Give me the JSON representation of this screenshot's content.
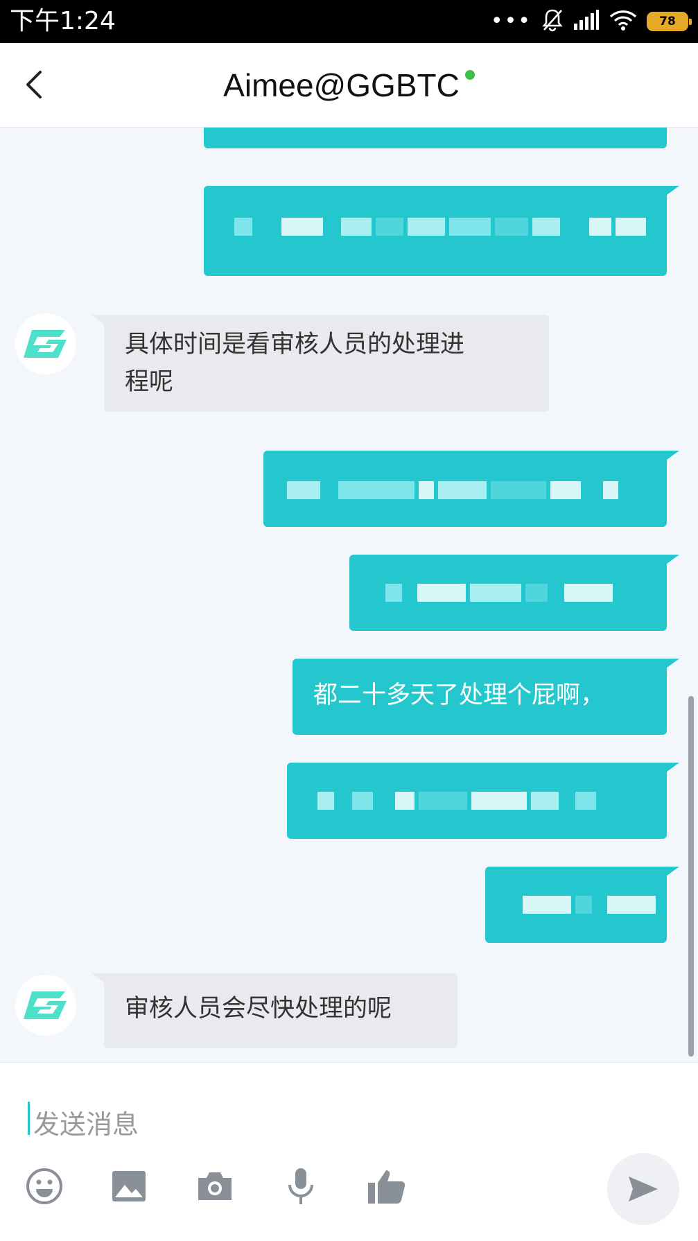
{
  "status_bar": {
    "time": "下午1:24",
    "battery_level": "78",
    "icons": [
      "more-dots-icon",
      "mute-bell-icon",
      "signal-icon",
      "wifi-icon",
      "battery-icon"
    ]
  },
  "header": {
    "back_icon": "chevron-left-icon",
    "title": "Aimee@GGBTC",
    "online_color": "#3fbf4a"
  },
  "colors": {
    "accent": "#25c7cf",
    "incoming_bubble": "#e8eaee",
    "background": "#f3f6fa"
  },
  "messages": [
    {
      "sender": "me",
      "text": "",
      "redacted": true
    },
    {
      "sender": "me",
      "text": "",
      "redacted": true
    },
    {
      "sender": "agent",
      "text": "具体时间是看审核人员的处理进\n程呢"
    },
    {
      "sender": "me",
      "text": "",
      "redacted": true
    },
    {
      "sender": "me",
      "text": "",
      "redacted": true
    },
    {
      "sender": "me",
      "text": "都二十多天了处理个屁啊，"
    },
    {
      "sender": "me",
      "text": "",
      "redacted": true
    },
    {
      "sender": "me",
      "text": "",
      "redacted": true
    },
    {
      "sender": "agent",
      "text": "审核人员会尽快处理的呢"
    }
  ],
  "composer": {
    "placeholder": "发送消息",
    "tools": [
      "emoji-icon",
      "image-icon",
      "camera-icon",
      "microphone-icon",
      "thumbs-up-icon"
    ],
    "send_icon": "send-icon"
  }
}
